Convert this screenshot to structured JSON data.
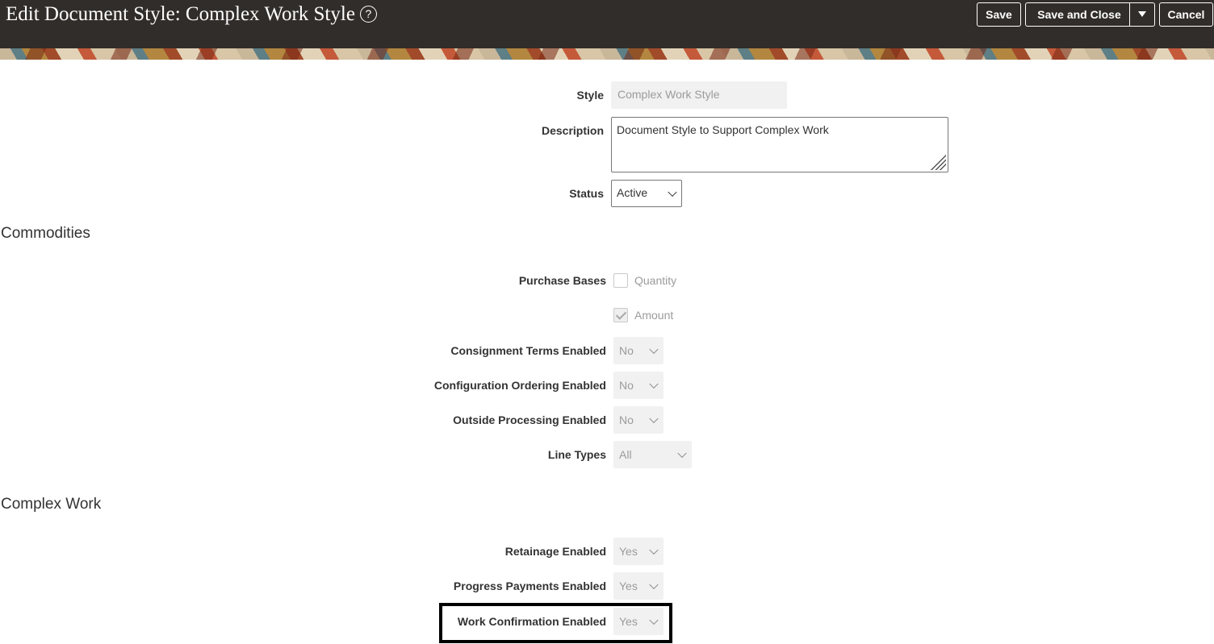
{
  "header": {
    "title": "Edit Document Style: Complex Work Style",
    "help_icon": "help-icon",
    "save_label": "Save",
    "save_and_close_label": "Save and Close",
    "cancel_label": "Cancel"
  },
  "form": {
    "style_label": "Style",
    "style_value": "Complex Work Style",
    "description_label": "Description",
    "description_value": "Document Style to Support Complex Work",
    "status_label": "Status",
    "status_value": "Active"
  },
  "commodities": {
    "title": "Commodities",
    "purchase_bases_label": "Purchase Bases",
    "quantity_label": "Quantity",
    "quantity_checked": false,
    "amount_label": "Amount",
    "amount_checked": true,
    "consignment_label": "Consignment Terms Enabled",
    "consignment_value": "No",
    "config_ordering_label": "Configuration Ordering Enabled",
    "config_ordering_value": "No",
    "outside_processing_label": "Outside Processing Enabled",
    "outside_processing_value": "No",
    "line_types_label": "Line Types",
    "line_types_value": "All"
  },
  "complex_work": {
    "title": "Complex Work",
    "retainage_label": "Retainage Enabled",
    "retainage_value": "Yes",
    "progress_payments_label": "Progress Payments Enabled",
    "progress_payments_value": "Yes",
    "work_confirmation_label": "Work Confirmation Enabled",
    "work_confirmation_value": "Yes"
  }
}
